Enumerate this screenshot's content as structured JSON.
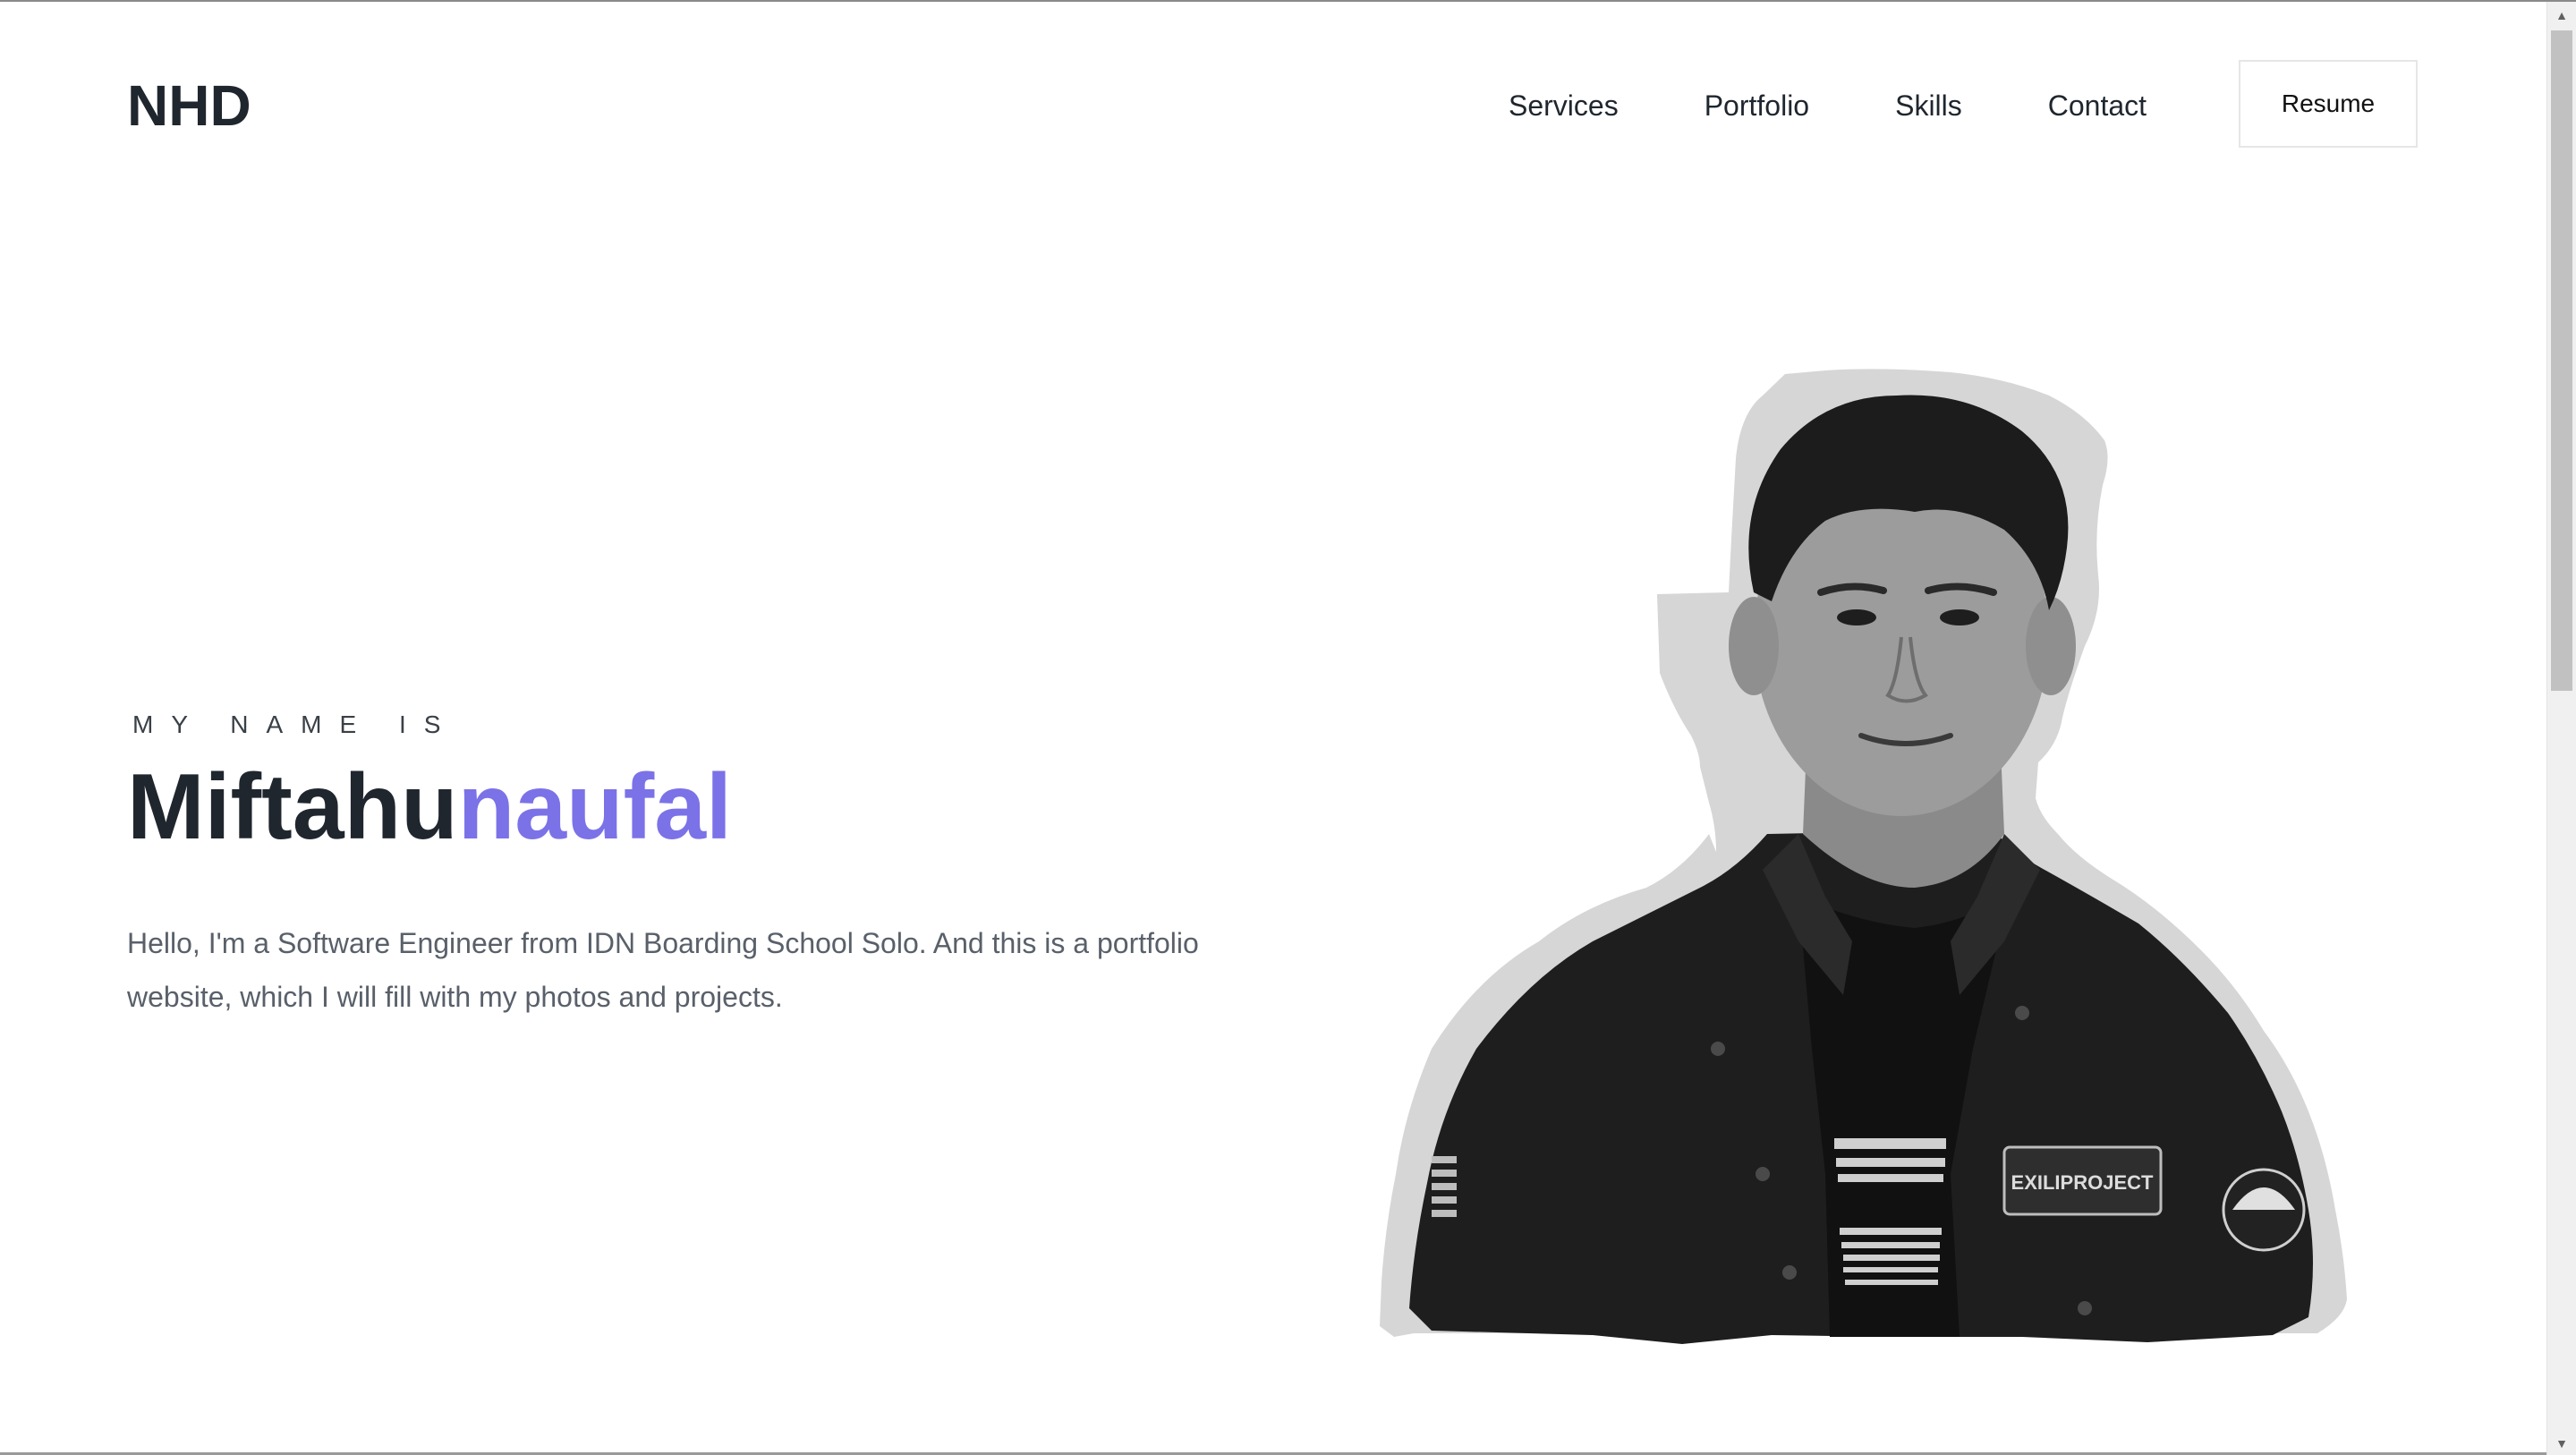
{
  "header": {
    "logo": "NHD",
    "nav": [
      {
        "label": "Services"
      },
      {
        "label": "Portfolio"
      },
      {
        "label": "Skills"
      },
      {
        "label": "Contact"
      }
    ],
    "resume_label": "Resume"
  },
  "hero": {
    "eyebrow": "MY NAME IS",
    "first_name": "Miftahu",
    "last_name": "naufal",
    "description": "Hello, I'm a Software Engineer from IDN Boarding School Solo. And this is a portfolio website, which I will fill with my photos and projects.",
    "portrait_patch_text": "EXILIPROJECT"
  },
  "colors": {
    "accent": "#7b72e8",
    "text_dark": "#1f262e",
    "text_muted": "#59606a"
  },
  "icons": {
    "scroll_up": "triangle-up-icon",
    "scroll_down": "triangle-down-icon"
  }
}
